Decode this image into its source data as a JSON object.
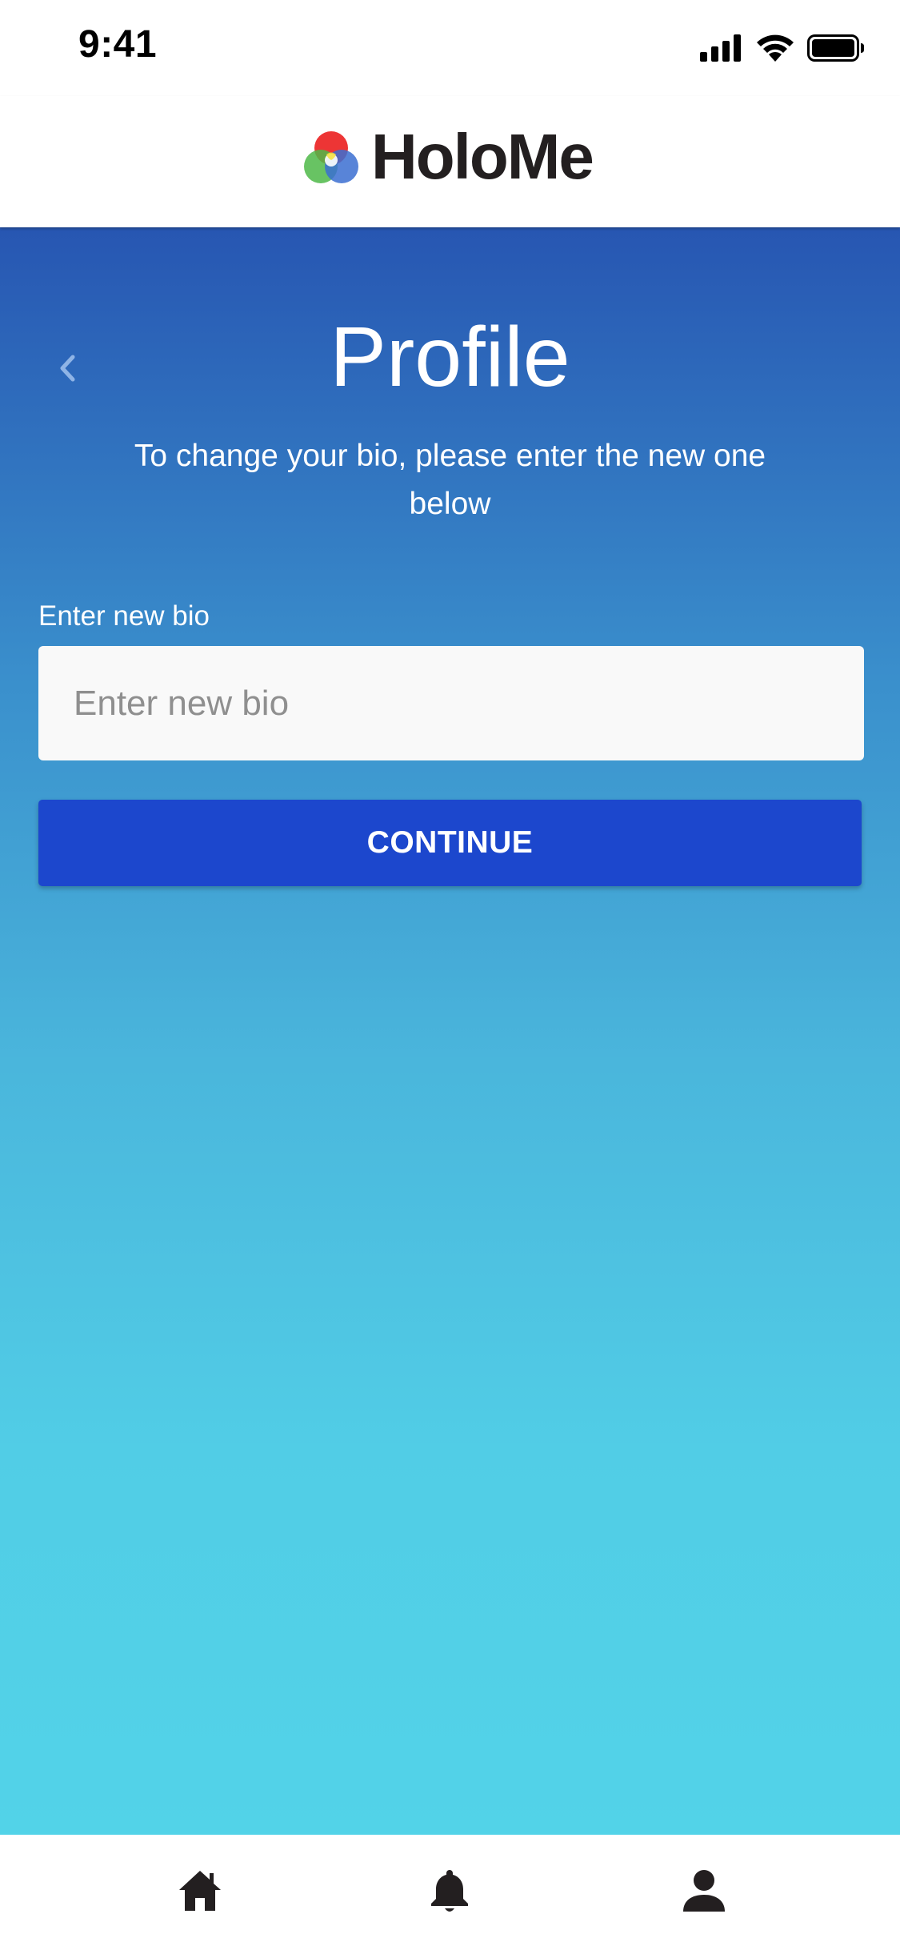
{
  "status_bar": {
    "time": "9:41",
    "icons": [
      "cellular-signal-icon",
      "wifi-icon",
      "battery-icon"
    ]
  },
  "header": {
    "brand_name": "HoloMe",
    "logo_icon": "holome-logo-icon"
  },
  "main": {
    "title": "Profile",
    "subtitle": "To change your bio, please enter the new one below",
    "back_icon": "chevron-left-icon",
    "bio_field": {
      "label": "Enter new bio",
      "placeholder": "Enter new bio",
      "value": ""
    },
    "continue_label": "CONTINUE"
  },
  "tab_bar": {
    "items": [
      {
        "icon": "home-icon"
      },
      {
        "icon": "bell-icon"
      },
      {
        "icon": "person-icon"
      }
    ]
  },
  "colors": {
    "gradient_top": "#2756b2",
    "gradient_bottom": "#52d3e8",
    "button": "#1c47cd",
    "icon_dark": "#231f20"
  }
}
